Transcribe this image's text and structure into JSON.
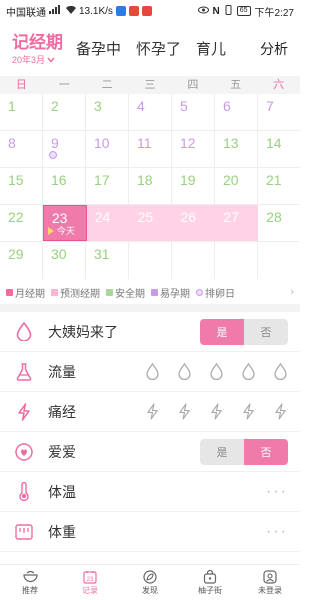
{
  "status_bar": {
    "carrier": "中国联通",
    "speed": "13.1K/s",
    "battery": "65",
    "time": "下午2:27"
  },
  "header": {
    "active_tab": "记经期",
    "date": "20年3月",
    "tabs": [
      "备孕中",
      "怀孕了",
      "育儿"
    ],
    "analysis": "分析"
  },
  "calendar": {
    "weekdays": [
      "日",
      "一",
      "二",
      "三",
      "四",
      "五",
      "六"
    ],
    "rows": [
      [
        {
          "d": "1",
          "t": "safe"
        },
        {
          "d": "2",
          "t": "safe"
        },
        {
          "d": "3",
          "t": "safe"
        },
        {
          "d": "4",
          "t": "fertile"
        },
        {
          "d": "5",
          "t": "fertile"
        },
        {
          "d": "6",
          "t": "fertile"
        },
        {
          "d": "7",
          "t": "fertile"
        }
      ],
      [
        {
          "d": "8",
          "t": "fertile"
        },
        {
          "d": "9",
          "t": "ovul"
        },
        {
          "d": "10",
          "t": "fertile"
        },
        {
          "d": "11",
          "t": "fertile"
        },
        {
          "d": "12",
          "t": "fertile"
        },
        {
          "d": "13",
          "t": "safe"
        },
        {
          "d": "14",
          "t": "safe"
        }
      ],
      [
        {
          "d": "15",
          "t": "safe"
        },
        {
          "d": "16",
          "t": "safe"
        },
        {
          "d": "17",
          "t": "safe"
        },
        {
          "d": "18",
          "t": "safe"
        },
        {
          "d": "19",
          "t": "safe"
        },
        {
          "d": "20",
          "t": "safe"
        },
        {
          "d": "21",
          "t": "safe"
        }
      ],
      [
        {
          "d": "22",
          "t": "safe"
        },
        {
          "d": "23",
          "t": "today"
        },
        {
          "d": "24",
          "t": "period"
        },
        {
          "d": "25",
          "t": "period"
        },
        {
          "d": "26",
          "t": "period"
        },
        {
          "d": "27",
          "t": "period"
        },
        {
          "d": "28",
          "t": "safe"
        }
      ],
      [
        {
          "d": "29",
          "t": "safe"
        },
        {
          "d": "30",
          "t": "safe"
        },
        {
          "d": "31",
          "t": "safe"
        },
        {
          "d": "",
          "t": "empty"
        },
        {
          "d": "",
          "t": "empty"
        },
        {
          "d": "",
          "t": "empty"
        },
        {
          "d": "",
          "t": "empty"
        }
      ]
    ],
    "today_label": "今天"
  },
  "legend": [
    {
      "label": "月经期",
      "color": "#ee6ea3"
    },
    {
      "label": "预测经期",
      "color": "#f8b7d2"
    },
    {
      "label": "安全期",
      "color": "#a8d99a"
    },
    {
      "label": "易孕期",
      "color": "#c79be9"
    },
    {
      "label": "排卵日",
      "color": "#c79be9"
    }
  ],
  "records": {
    "period_came": {
      "label": "大姨妈来了",
      "yes": "是",
      "no": "否",
      "selected": "是"
    },
    "flow": {
      "label": "流量"
    },
    "cramps": {
      "label": "痛经"
    },
    "love": {
      "label": "爱爱",
      "yes": "是",
      "no": "否",
      "selected": "否"
    },
    "temperature": {
      "label": "体温"
    },
    "weight": {
      "label": "体重"
    }
  },
  "bottom_nav": [
    {
      "label": "推荐"
    },
    {
      "label": "记录"
    },
    {
      "label": "发现"
    },
    {
      "label": "柚子街"
    },
    {
      "label": "未登录"
    }
  ],
  "colors": {
    "accent": "#ee6ea3",
    "period": "#f07aaa",
    "predicted": "#ffd2e6",
    "safe": "#98d181",
    "fertile": "#c79be9"
  }
}
